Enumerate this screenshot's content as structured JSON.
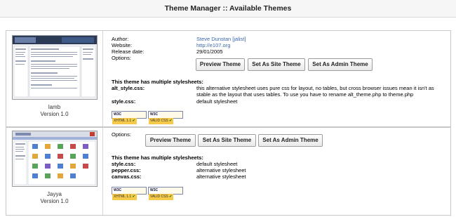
{
  "header": {
    "title": "Theme Manager :: Available Themes"
  },
  "labels": {
    "author": "Author:",
    "website": "Website:",
    "release_date": "Release date:",
    "options": "Options:",
    "multiple": "This theme has multiple stylesheets:"
  },
  "buttons": {
    "preview": "Preview Theme",
    "site": "Set As Site Theme",
    "admin": "Set As Admin Theme"
  },
  "badges": {
    "w3c": "W3C",
    "xhtml": "XHTML 1.1",
    "css": "VALID CSS"
  },
  "themes": [
    {
      "name": "lamb",
      "version": "Version 1.0",
      "author": "Steve Dunstan [jalist]",
      "website": "http://e107.org",
      "release_date": "29/01/2005",
      "stylesheets": [
        {
          "file": "alt_style.css:",
          "desc": "this alternative stylesheet uses pure css for layout, no tables, but cross browser issues mean it isn't as stable as the layout that uses tables. To use you have to rename alt_theme.php to theme.php"
        },
        {
          "file": "style.css:",
          "desc": "default stylesheet"
        }
      ]
    },
    {
      "name": "Jayya",
      "version": "Version 1.0",
      "stylesheets": [
        {
          "file": "style.css:",
          "desc": "default stylesheet"
        },
        {
          "file": "pepper.css:",
          "desc": "alternative stylesheet"
        },
        {
          "file": "canvas.css:",
          "desc": "alternative stylesheet"
        }
      ]
    }
  ]
}
